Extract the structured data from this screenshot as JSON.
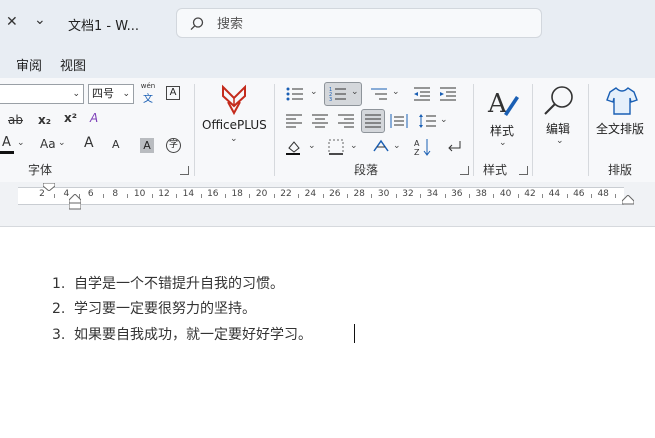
{
  "window": {
    "close_glyph": "✕",
    "qat_glyph": "⌄",
    "title": "文档1  -  W..."
  },
  "search": {
    "placeholder": "搜索",
    "value": ""
  },
  "tabs": [
    {
      "label": "审阅"
    },
    {
      "label": "视图"
    }
  ],
  "ribbon": {
    "font": {
      "size_value": "四号",
      "wen_top": "wén",
      "wen_bottom": "文",
      "char_border": "A",
      "strike": "ab",
      "subscript": "x₂",
      "superscript": "x²",
      "clear_format": "A",
      "font_color": "A",
      "change_case": "Aa",
      "grow": "A",
      "shrink": "A",
      "char_shading": "A",
      "enclose": "字",
      "group_label": "字体"
    },
    "officeplus": {
      "label": "OfficePLUS"
    },
    "paragraph": {
      "group_label": "段落"
    },
    "styles": {
      "label": "样式",
      "group_label": "样式"
    },
    "editing": {
      "label": "编辑"
    },
    "layout": {
      "label": "全文排版",
      "group_label": "排版"
    }
  },
  "ruler": {
    "numbers": [
      "2",
      "4",
      "6",
      "8",
      "10",
      "12",
      "14",
      "16",
      "18",
      "20",
      "22",
      "24",
      "26",
      "28",
      "30",
      "32",
      "34",
      "36",
      "38",
      "40",
      "42",
      "44",
      "46",
      "48"
    ]
  },
  "document": {
    "items": [
      {
        "num": "1.",
        "text": "自学是一个不错提升自我的习惯。"
      },
      {
        "num": "2.",
        "text": "学习要一定要很努力的坚持。"
      },
      {
        "num": "3.",
        "text": "如果要自我成功，就一定要好好学习。"
      }
    ]
  },
  "colors": {
    "accent": "#c42b1c",
    "chrome": "#e8edf3",
    "ribbon": "#f7f8fa"
  }
}
